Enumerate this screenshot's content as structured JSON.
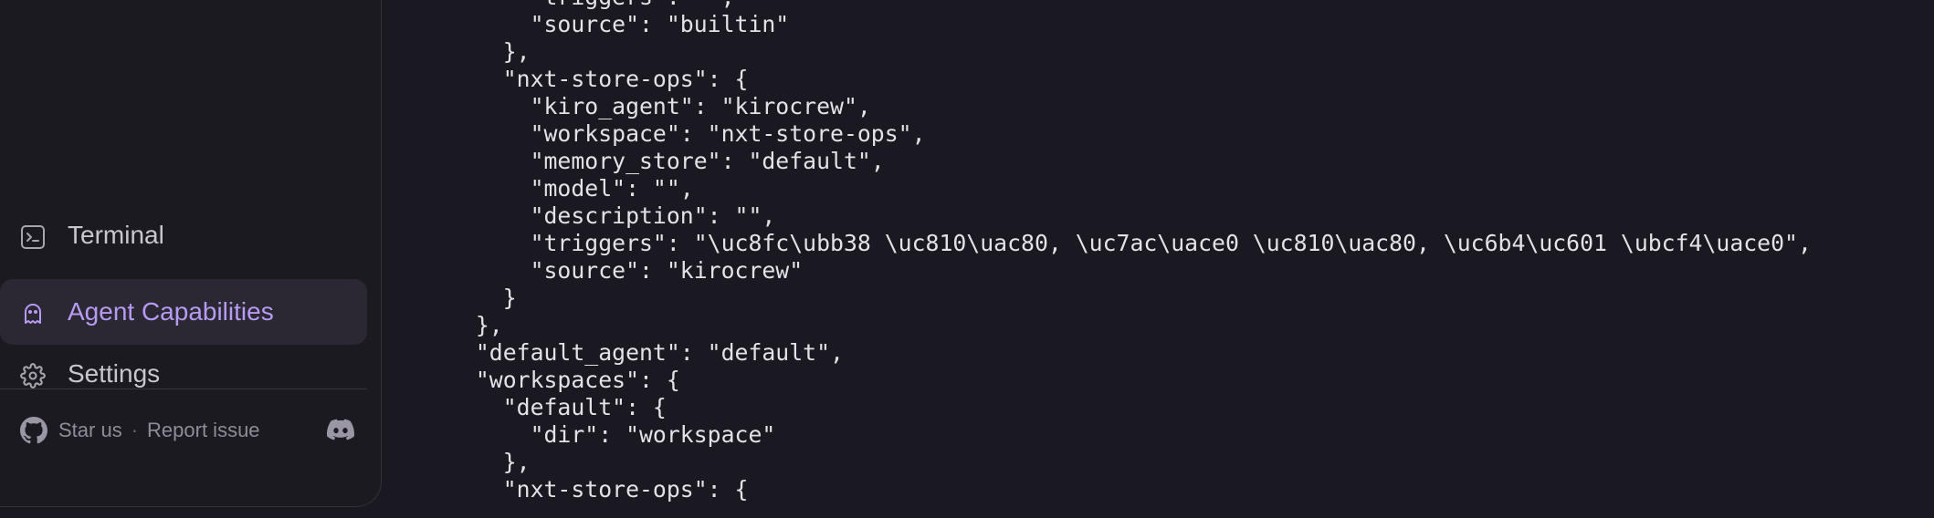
{
  "sidebar": {
    "nav": [
      {
        "label": "Terminal",
        "icon": "terminal-icon",
        "active": false
      },
      {
        "label": "Agent Capabilities",
        "icon": "ghost-icon",
        "active": true
      },
      {
        "label": "Settings",
        "icon": "gear-icon",
        "active": false
      }
    ],
    "footer": {
      "star_label": "Star us",
      "separator": "·",
      "report_label": "Report issue",
      "github_icon": "github-icon",
      "discord_icon": "discord-icon"
    }
  },
  "colors": {
    "accent": "#b79af2",
    "background": "#1a1820",
    "active_item_bg": "#2b2833"
  },
  "code": {
    "lines": [
      "      \"triggers\": \"\",",
      "      \"source\": \"builtin\"",
      "    },",
      "    \"nxt-store-ops\": {",
      "      \"kiro_agent\": \"kirocrew\",",
      "      \"workspace\": \"nxt-store-ops\",",
      "      \"memory_store\": \"default\",",
      "      \"model\": \"\",",
      "      \"description\": \"\",",
      "      \"triggers\": \"\\uc8fc\\ubb38 \\uc810\\uac80, \\uc7ac\\uace0 \\uc810\\uac80, \\uc6b4\\uc601 \\ubcf4\\uace0\",",
      "      \"source\": \"kirocrew\"",
      "    }",
      "  },",
      "  \"default_agent\": \"default\",",
      "  \"workspaces\": {",
      "    \"default\": {",
      "      \"dir\": \"workspace\"",
      "    },",
      "    \"nxt-store-ops\": {"
    ]
  }
}
